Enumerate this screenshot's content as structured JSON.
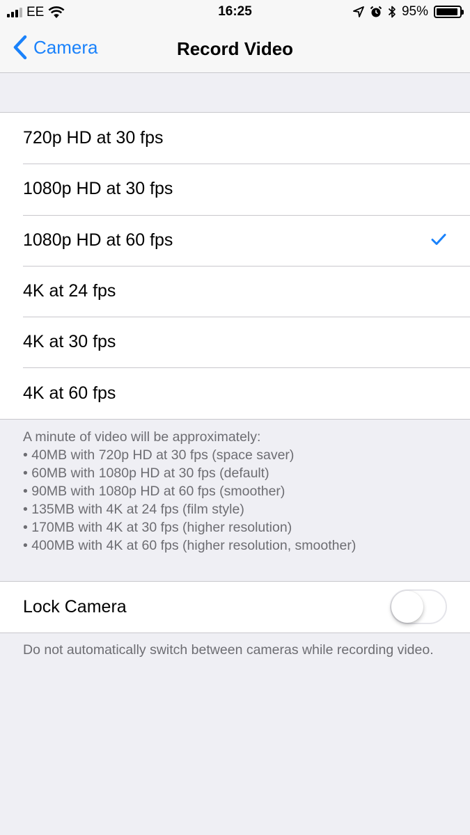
{
  "status_bar": {
    "carrier": "EE",
    "time": "16:25",
    "battery_percent": "95%",
    "battery_level": 0.95,
    "icons": [
      "signal-icon",
      "wifi-icon",
      "location-icon",
      "alarm-icon",
      "bluetooth-icon",
      "battery-icon"
    ]
  },
  "nav": {
    "back_label": "Camera",
    "title": "Record Video"
  },
  "options": [
    {
      "label": "720p HD at 30 fps",
      "selected": false
    },
    {
      "label": "1080p HD at 30 fps",
      "selected": false
    },
    {
      "label": "1080p HD at 60 fps",
      "selected": true
    },
    {
      "label": "4K at 24 fps",
      "selected": false
    },
    {
      "label": "4K at 30 fps",
      "selected": false
    },
    {
      "label": "4K at 60 fps",
      "selected": false
    }
  ],
  "size_note": {
    "heading": "A minute of video will be approximately:",
    "lines": [
      "• 40MB with 720p HD at 30 fps (space saver)",
      "• 60MB with 1080p HD at 30 fps (default)",
      "• 90MB with 1080p HD at 60 fps (smoother)",
      "• 135MB with 4K at 24 fps (film style)",
      "• 170MB with 4K at 30 fps (higher resolution)",
      "• 400MB with 4K at 60 fps (higher resolution, smoother)"
    ]
  },
  "lock_camera": {
    "label": "Lock Camera",
    "enabled": false,
    "note": "Do not automatically switch between cameras while recording video."
  },
  "colors": {
    "accent": "#1a82fb",
    "background": "#efeff4",
    "separator": "#c8c7cc",
    "footer_text": "#6d6d72"
  }
}
